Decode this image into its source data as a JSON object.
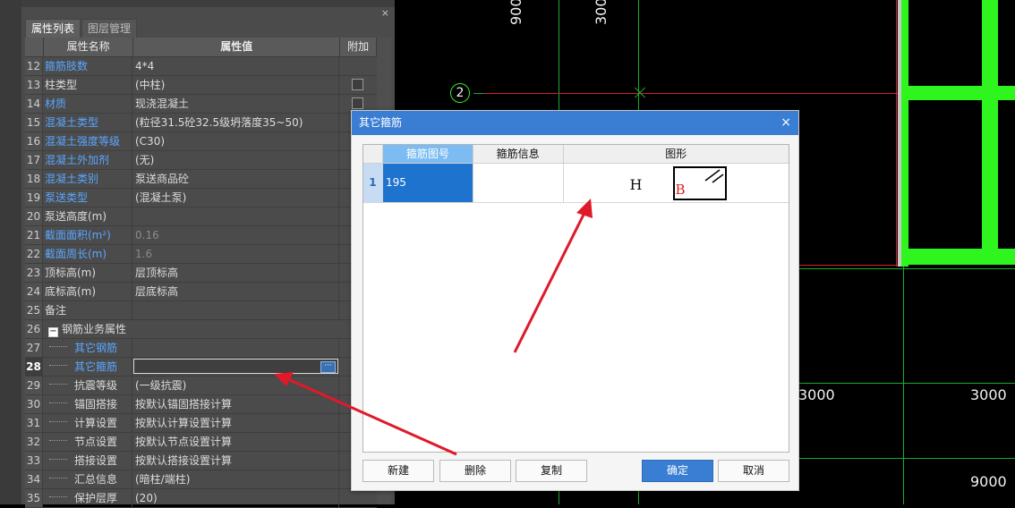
{
  "panel": {
    "tabs": [
      "属性列表",
      "图层管理"
    ],
    "close_glyph": "×",
    "headers": {
      "name": "属性名称",
      "value": "属性值",
      "extra": "附加"
    },
    "rows": [
      {
        "num": "12",
        "name": "箍筋肢数",
        "value": "4*4"
      },
      {
        "num": "13",
        "name": "柱类型",
        "value": "(中柱)"
      },
      {
        "num": "14",
        "name": "材质",
        "value": "现浇混凝土"
      },
      {
        "num": "15",
        "name": "混凝土类型",
        "value": "(粒径31.5砼32.5级坍落度35~50)"
      },
      {
        "num": "16",
        "name": "混凝土强度等级",
        "value": "(C30)"
      },
      {
        "num": "17",
        "name": "混凝土外加剂",
        "value": "(无)"
      },
      {
        "num": "18",
        "name": "混凝土类别",
        "value": "泵送商品砼"
      },
      {
        "num": "19",
        "name": "泵送类型",
        "value": "(混凝土泵)"
      },
      {
        "num": "20",
        "name": "泵送高度(m)",
        "value": ""
      },
      {
        "num": "21",
        "name": "截面面积(m²)",
        "value": "0.16"
      },
      {
        "num": "22",
        "name": "截面周长(m)",
        "value": "1.6"
      },
      {
        "num": "23",
        "name": "顶标高(m)",
        "value": "层顶标高"
      },
      {
        "num": "24",
        "name": "底标高(m)",
        "value": "层底标高"
      },
      {
        "num": "25",
        "name": "备注",
        "value": ""
      },
      {
        "num": "26",
        "name": "钢筋业务属性",
        "value": ""
      },
      {
        "num": "27",
        "name": "其它钢筋",
        "value": ""
      },
      {
        "num": "28",
        "name": "其它箍筋",
        "value": ""
      },
      {
        "num": "29",
        "name": "抗震等级",
        "value": "(一级抗震)"
      },
      {
        "num": "30",
        "name": "锚固搭接",
        "value": "按默认锚固搭接计算"
      },
      {
        "num": "31",
        "name": "计算设置",
        "value": "按默认计算设置计算"
      },
      {
        "num": "32",
        "name": "节点设置",
        "value": "按默认节点设置计算"
      },
      {
        "num": "33",
        "name": "搭接设置",
        "value": "按默认搭接设置计算"
      },
      {
        "num": "34",
        "name": "汇总信息",
        "value": "(暗柱/端柱)"
      },
      {
        "num": "35",
        "name": "保护层厚",
        "value": "(20)"
      }
    ],
    "toggle_glyph": "−",
    "ellipsis_glyph": "···"
  },
  "cad": {
    "axis_label": "2",
    "labels": {
      "top_left": "9000",
      "top_mid": "3000",
      "mid_left": "3000",
      "mid_right": "3000",
      "bottom_right": "9000"
    }
  },
  "dialog": {
    "title": "其它箍筋",
    "close_glyph": "×",
    "columns": [
      "箍筋图号",
      "箍筋信息",
      "图形"
    ],
    "rows": [
      {
        "index": "1",
        "figure_no": "195",
        "info": "",
        "shape_h": "H",
        "shape_b": "B"
      }
    ],
    "buttons": {
      "new": "新建",
      "delete": "删除",
      "copy": "复制",
      "ok": "确定",
      "cancel": "取消"
    }
  },
  "colors": {
    "accent": "#3a7ed4",
    "cad_green": "#17ad2f",
    "cad_red": "#d41f32",
    "arrow": "#e0192a",
    "link_blue": "#5aa6ff"
  }
}
